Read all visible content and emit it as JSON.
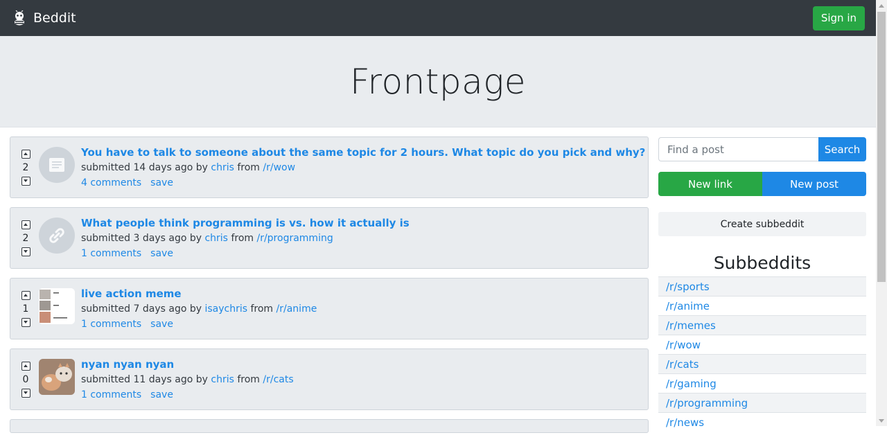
{
  "brand": {
    "name": "Beddit",
    "logo_icon": "bee-mascot-icon"
  },
  "nav": {
    "signin_label": "Sign in"
  },
  "page": {
    "title": "Frontpage"
  },
  "colors": {
    "accent": "#1e88e5",
    "success": "#28a745",
    "navbar": "#343a40",
    "jumbotron": "#e9ecef"
  },
  "posts": [
    {
      "score": "2",
      "title": "You have to talk to someone about the same topic for 2 hours. What topic do you pick and why?",
      "submitted": "submitted 14 days ago by",
      "author": "chris",
      "from": "from",
      "subreddit": "/r/wow",
      "comments": "4 comments",
      "save": "save",
      "thumb": "text-post-icon"
    },
    {
      "score": "2",
      "title": "What people think programming is vs. how it actually is",
      "submitted": "submitted 3 days ago by",
      "author": "chris",
      "from": "from",
      "subreddit": "/r/programming",
      "comments": "1 comments",
      "save": "save",
      "thumb": "link-icon"
    },
    {
      "score": "1",
      "title": "live action meme",
      "submitted": "submitted 7 days ago by",
      "author": "isaychris",
      "from": "from",
      "subreddit": "/r/anime",
      "comments": "1 comments",
      "save": "save",
      "thumb": "meme-image-thumbnail"
    },
    {
      "score": "0",
      "title": "nyan nyan nyan",
      "submitted": "submitted 11 days ago by",
      "author": "chris",
      "from": "from",
      "subreddit": "/r/cats",
      "comments": "1 comments",
      "save": "save",
      "thumb": "cat-photo-thumbnail"
    }
  ],
  "sidebar": {
    "search_placeholder": "Find a post",
    "search_label": "Search",
    "new_link_label": "New link",
    "new_post_label": "New post",
    "create_sub_label": "Create subbeddit",
    "subs_heading": "Subbeddits",
    "subs": [
      "/r/sports",
      "/r/anime",
      "/r/memes",
      "/r/wow",
      "/r/cats",
      "/r/gaming",
      "/r/programming",
      "/r/news"
    ]
  }
}
